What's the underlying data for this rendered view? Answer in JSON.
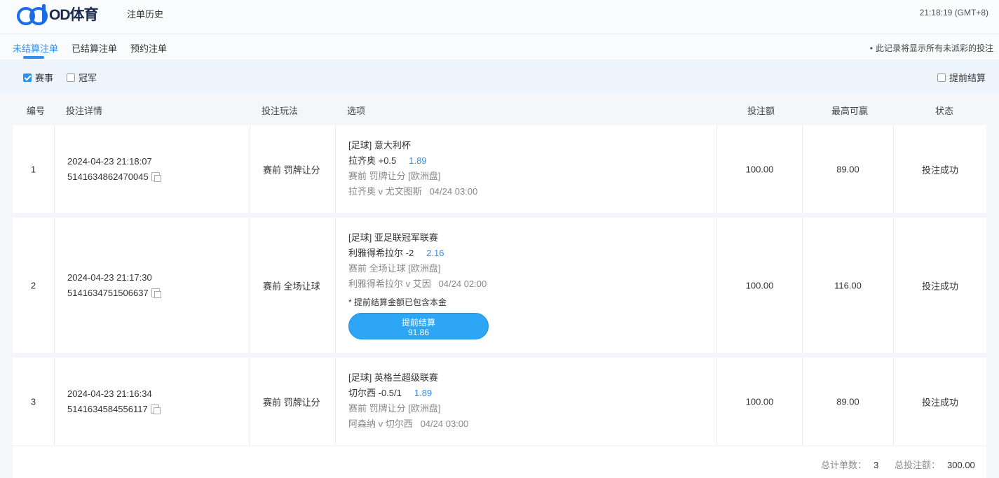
{
  "header": {
    "logo_text": "OD体育",
    "page_title": "注单历史",
    "clock": "21:18:19 (GMT+8)"
  },
  "tabs": {
    "items": [
      "未结算注单",
      "已结算注单",
      "预约注单"
    ],
    "note": "此记录将显示所有未派彩的投注"
  },
  "filters": {
    "match_label": "赛事",
    "champion_label": "冠军",
    "cashout_label": "提前结算"
  },
  "columns": {
    "no": "编号",
    "details": "投注详情",
    "play": "投注玩法",
    "option": "选项",
    "stake": "投注额",
    "max_win": "最高可赢",
    "status": "状态"
  },
  "rows": [
    {
      "no": "1",
      "time": "2024-04-23 21:18:07",
      "ticket": "5141634862470045",
      "play": "赛前  罚牌让分",
      "league": "[足球] 意大利杯",
      "pick": "拉齐奥 +0.5",
      "odds": "1.89",
      "market": "赛前 罚牌让分 [欧洲盘]",
      "match": "拉齐奥 v 尤文图斯",
      "match_time": "04/24 03:00",
      "stake": "100.00",
      "max_win": "89.00",
      "status": "投注成功"
    },
    {
      "no": "2",
      "time": "2024-04-23 21:17:30",
      "ticket": "5141634751506637",
      "play": "赛前  全场让球",
      "league": "[足球] 亚足联冠军联赛",
      "pick": "利雅得希拉尔 -2",
      "odds": "2.16",
      "market": "赛前 全场让球 [欧洲盘]",
      "match": "利雅得希拉尔 v 艾因",
      "match_time": "04/24 02:00",
      "cashout_note": "* 提前结算金额已包含本金",
      "cashout_label": "提前结算",
      "cashout_value": "91.86",
      "stake": "100.00",
      "max_win": "116.00",
      "status": "投注成功"
    },
    {
      "no": "3",
      "time": "2024-04-23 21:16:34",
      "ticket": "5141634584556117",
      "play": "赛前  罚牌让分",
      "league": "[足球] 英格兰超级联赛",
      "pick": "切尔西 -0.5/1",
      "odds": "1.89",
      "market": "赛前 罚牌让分 [欧洲盘]",
      "match": "阿森纳 v 切尔西",
      "match_time": "04/24 03:00",
      "stake": "100.00",
      "max_win": "89.00",
      "status": "投注成功"
    }
  ],
  "summary": {
    "count_label": "总计单数：",
    "count_value": "3",
    "total_label": "总投注额：",
    "total_value": "300.00"
  },
  "colors": {
    "accent": "#2d8ff0",
    "cashout_button": "#2da6f5",
    "logo": "#1c6be6"
  }
}
